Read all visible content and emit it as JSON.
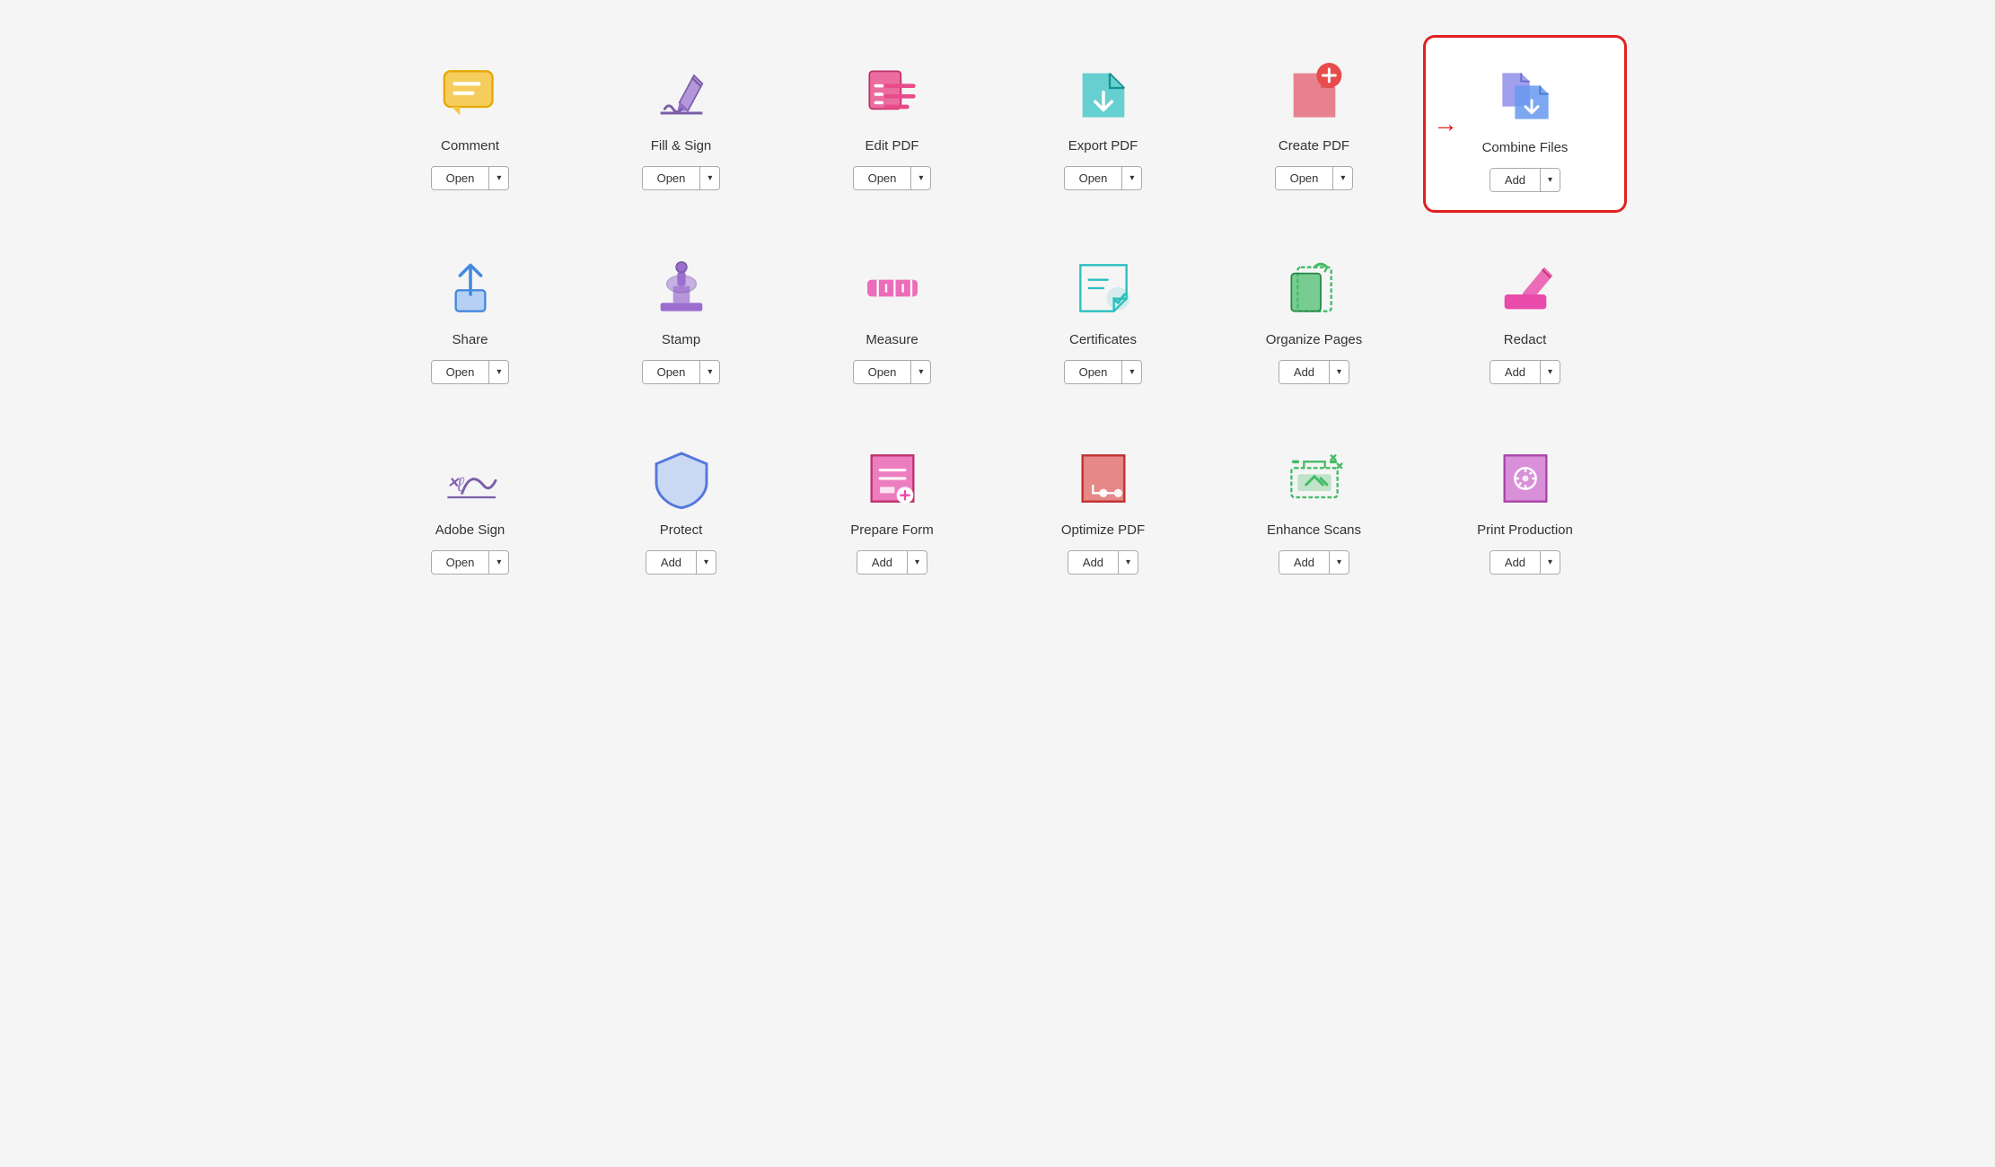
{
  "tools": [
    {
      "id": "comment",
      "label": "Comment",
      "btn": "Open",
      "highlighted": false,
      "icon_type": "comment"
    },
    {
      "id": "fill-sign",
      "label": "Fill & Sign",
      "btn": "Open",
      "highlighted": false,
      "icon_type": "fill-sign"
    },
    {
      "id": "edit-pdf",
      "label": "Edit PDF",
      "btn": "Open",
      "highlighted": false,
      "icon_type": "edit-pdf"
    },
    {
      "id": "export-pdf",
      "label": "Export PDF",
      "btn": "Open",
      "highlighted": false,
      "icon_type": "export-pdf"
    },
    {
      "id": "create-pdf",
      "label": "Create PDF",
      "btn": "Open",
      "highlighted": false,
      "icon_type": "create-pdf"
    },
    {
      "id": "combine-files",
      "label": "Combine Files",
      "btn": "Add",
      "highlighted": true,
      "icon_type": "combine-files"
    },
    {
      "id": "share",
      "label": "Share",
      "btn": "Open",
      "highlighted": false,
      "icon_type": "share"
    },
    {
      "id": "stamp",
      "label": "Stamp",
      "btn": "Open",
      "highlighted": false,
      "icon_type": "stamp"
    },
    {
      "id": "measure",
      "label": "Measure",
      "btn": "Open",
      "highlighted": false,
      "icon_type": "measure"
    },
    {
      "id": "certificates",
      "label": "Certificates",
      "btn": "Open",
      "highlighted": false,
      "icon_type": "certificates"
    },
    {
      "id": "organize-pages",
      "label": "Organize Pages",
      "btn": "Add",
      "highlighted": false,
      "icon_type": "organize-pages"
    },
    {
      "id": "redact",
      "label": "Redact",
      "btn": "Add",
      "highlighted": false,
      "icon_type": "redact"
    },
    {
      "id": "adobe-sign",
      "label": "Adobe Sign",
      "btn": "Open",
      "highlighted": false,
      "icon_type": "adobe-sign"
    },
    {
      "id": "protect",
      "label": "Protect",
      "btn": "Add",
      "highlighted": false,
      "icon_type": "protect"
    },
    {
      "id": "prepare-form",
      "label": "Prepare Form",
      "btn": "Add",
      "highlighted": false,
      "icon_type": "prepare-form"
    },
    {
      "id": "optimize-pdf",
      "label": "Optimize PDF",
      "btn": "Add",
      "highlighted": false,
      "icon_type": "optimize-pdf"
    },
    {
      "id": "enhance-scans",
      "label": "Enhance Scans",
      "btn": "Add",
      "highlighted": false,
      "icon_type": "enhance-scans"
    },
    {
      "id": "print-production",
      "label": "Print Production",
      "btn": "Add",
      "highlighted": false,
      "icon_type": "print-production"
    }
  ]
}
